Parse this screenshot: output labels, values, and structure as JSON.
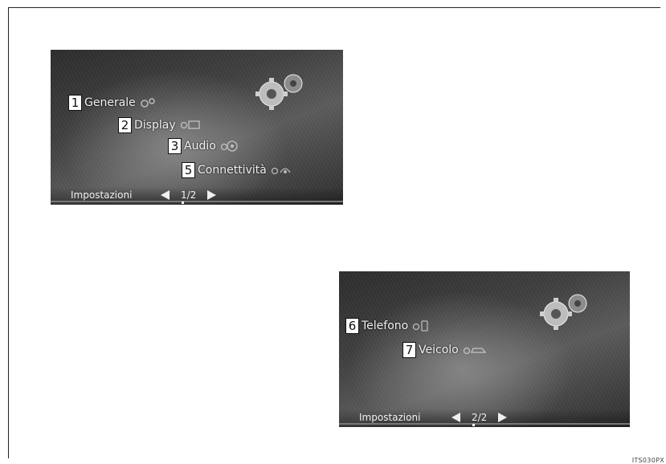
{
  "screens": [
    {
      "items": [
        {
          "num": "1",
          "label": "Generale",
          "icon": "gear-cluster-icon"
        },
        {
          "num": "2",
          "label": "Display",
          "icon": "display-settings-icon"
        },
        {
          "num": "3",
          "label": "Audio",
          "icon": "audio-settings-icon"
        },
        {
          "num": "5",
          "label": "Connettività",
          "icon": "connectivity-settings-icon"
        }
      ],
      "footer_title": "Impostazioni",
      "page": "1/2"
    },
    {
      "items": [
        {
          "num": "6",
          "label": "Telefono",
          "icon": "phone-settings-icon"
        },
        {
          "num": "7",
          "label": "Veicolo",
          "icon": "vehicle-settings-icon"
        }
      ],
      "footer_title": "Impostazioni",
      "page": "2/2"
    }
  ],
  "image_code": "ITS030PX",
  "colors": {
    "screen_dark": "#2c2c2c",
    "text": "#f2f2f2",
    "badge_bg": "#ffffff"
  }
}
